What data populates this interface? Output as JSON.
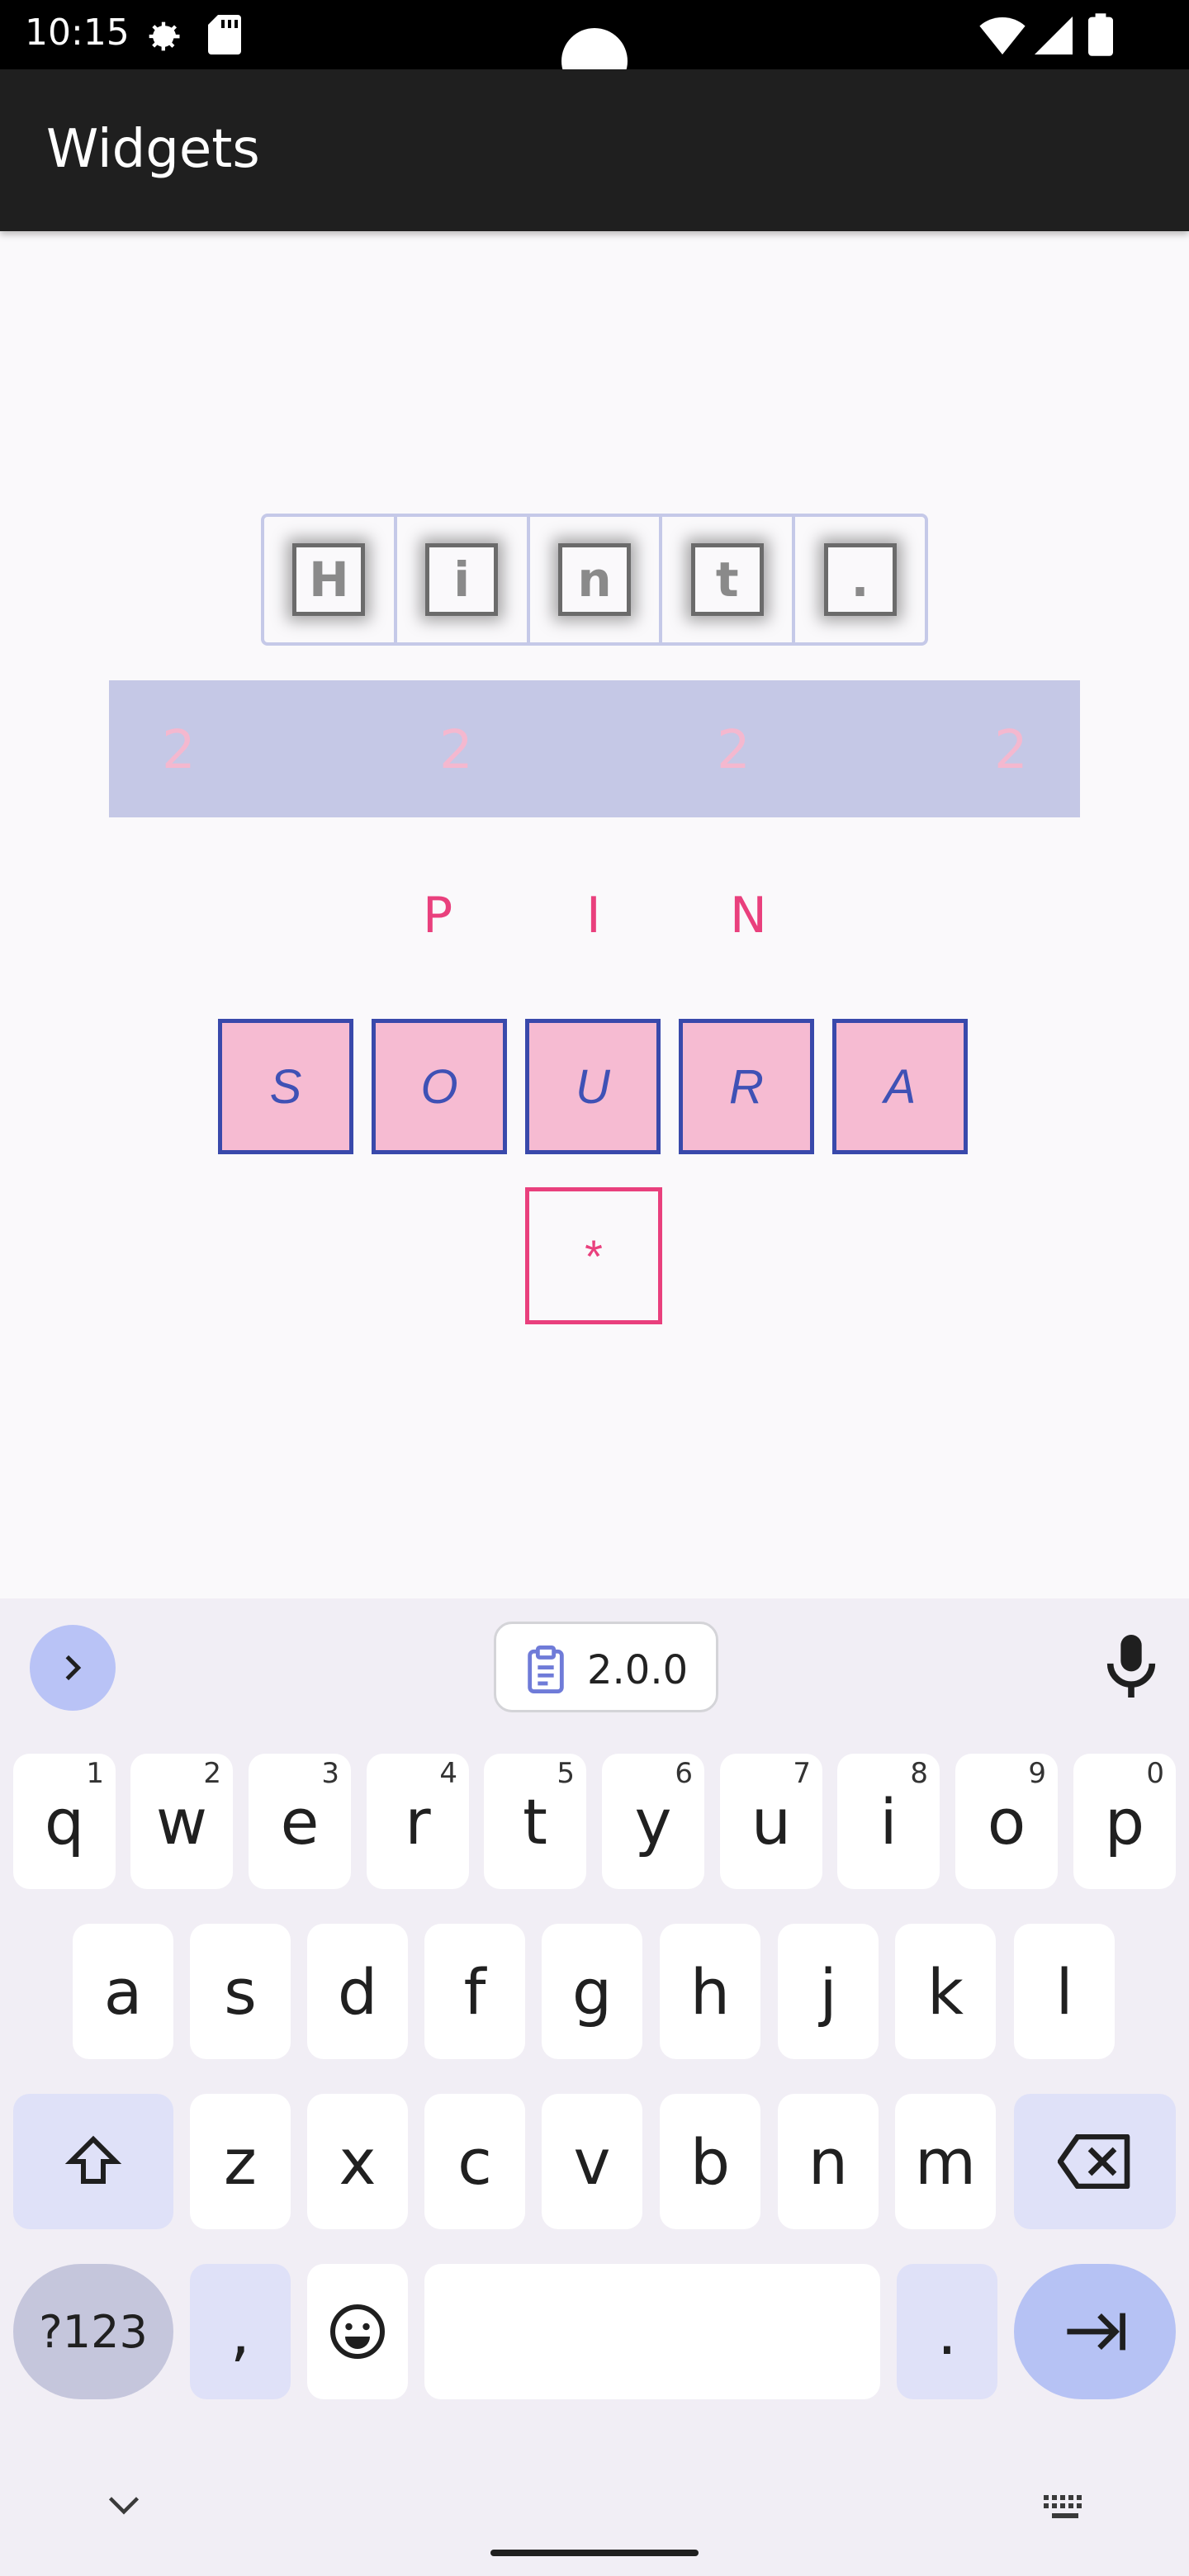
{
  "status_bar": {
    "time": "10:15"
  },
  "app_bar": {
    "title": "Widgets"
  },
  "hint_row": {
    "chars": [
      "H",
      "i",
      "n",
      "t",
      "."
    ]
  },
  "band": {
    "digits": [
      "2",
      "2",
      "2",
      "2"
    ]
  },
  "pin_row": {
    "letters": [
      "P",
      "I",
      "N"
    ]
  },
  "word_row": {
    "letters": [
      "S",
      "O",
      "U",
      "R",
      "A"
    ]
  },
  "star_box": {
    "text": "*"
  },
  "keyboard": {
    "clipboard_chip": "2.0.0",
    "row1": [
      {
        "k": "q",
        "n": "1"
      },
      {
        "k": "w",
        "n": "2"
      },
      {
        "k": "e",
        "n": "3"
      },
      {
        "k": "r",
        "n": "4"
      },
      {
        "k": "t",
        "n": "5"
      },
      {
        "k": "y",
        "n": "6"
      },
      {
        "k": "u",
        "n": "7"
      },
      {
        "k": "i",
        "n": "8"
      },
      {
        "k": "o",
        "n": "9"
      },
      {
        "k": "p",
        "n": "0"
      }
    ],
    "row2": [
      "a",
      "s",
      "d",
      "f",
      "g",
      "h",
      "j",
      "k",
      "l"
    ],
    "row3": [
      "z",
      "x",
      "c",
      "v",
      "b",
      "n",
      "m"
    ],
    "sym_label": "?123",
    "comma": ",",
    "period": "."
  },
  "colors": {
    "appbar": "#1f1f1f",
    "accent_pink": "#e9407d",
    "accent_indigo": "#3949ab",
    "band": "#c5c8e6",
    "tile_fill": "#f6bbd2"
  }
}
